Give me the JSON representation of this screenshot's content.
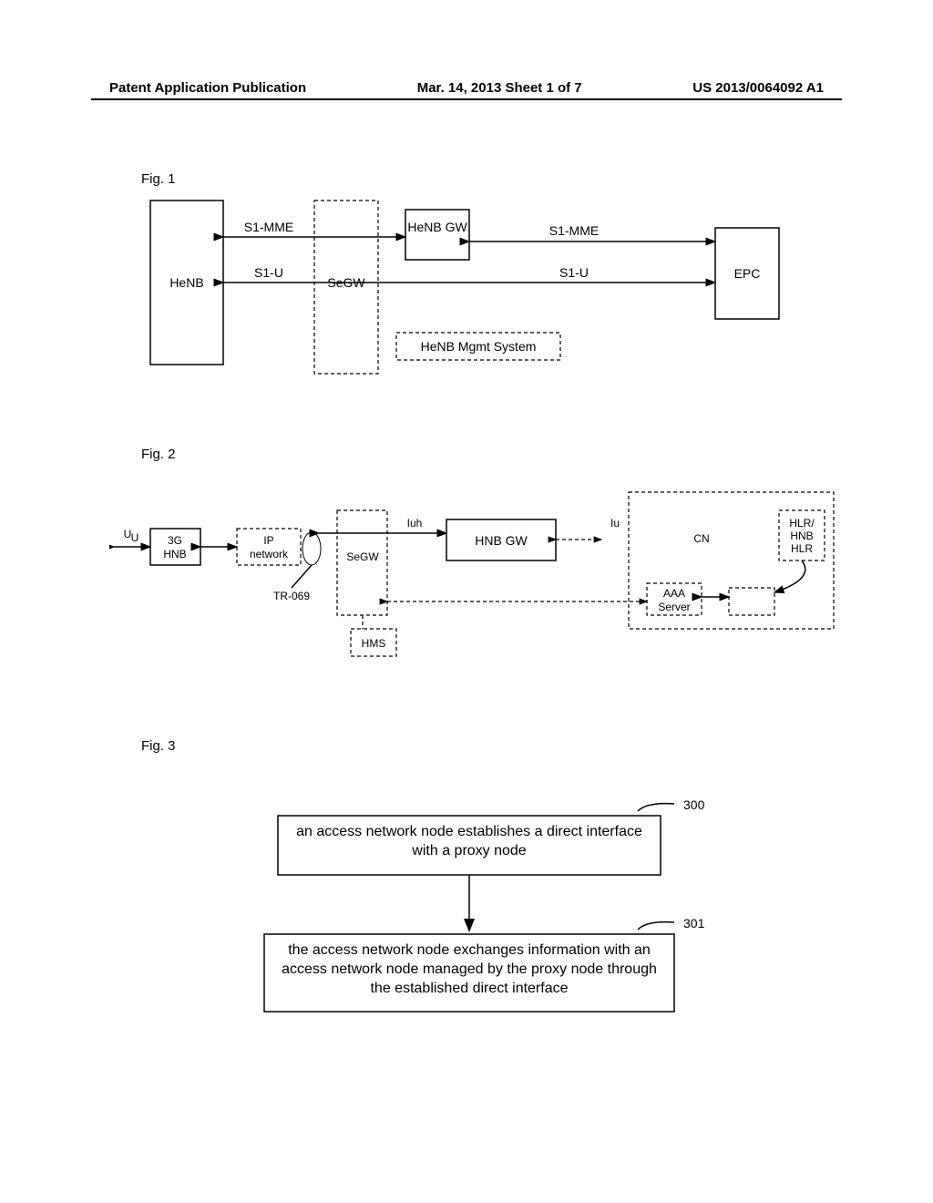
{
  "header": {
    "left": "Patent Application Publication",
    "center": "Mar. 14, 2013  Sheet 1 of 7",
    "right": "US 2013/0064092 A1"
  },
  "fig1": {
    "label": "Fig. 1",
    "henb": "HeNB",
    "segw": "SeGW",
    "henb_gw": "HeNB GW",
    "epc": "EPC",
    "mgmt": "HeNB Mgmt System",
    "s1mme": "S1-MME",
    "s1u": "S1-U",
    "s1mme2": "S1-MME",
    "s1u2": "S1-U"
  },
  "fig2": {
    "label": "Fig. 2",
    "uu": "U",
    "uu_sub": "U",
    "hnb_3g": "3G HNB",
    "ip_net": "IP network",
    "tr069": "TR-069",
    "segw": "SeGW",
    "hms": "HMS",
    "hnb_gw": "HNB GW",
    "iuh": "Iuh",
    "iu": "Iu",
    "cn": "CN",
    "hlr": "HLR/ HNB HLR",
    "aaa": "AAA Server"
  },
  "fig3": {
    "label": "Fig. 3",
    "step300_num": "300",
    "step300_text": "an access network node establishes a direct interface with a proxy node",
    "step301_num": "301",
    "step301_text": "the access network node exchanges information with an access network node managed by the proxy node through the established direct interface"
  }
}
